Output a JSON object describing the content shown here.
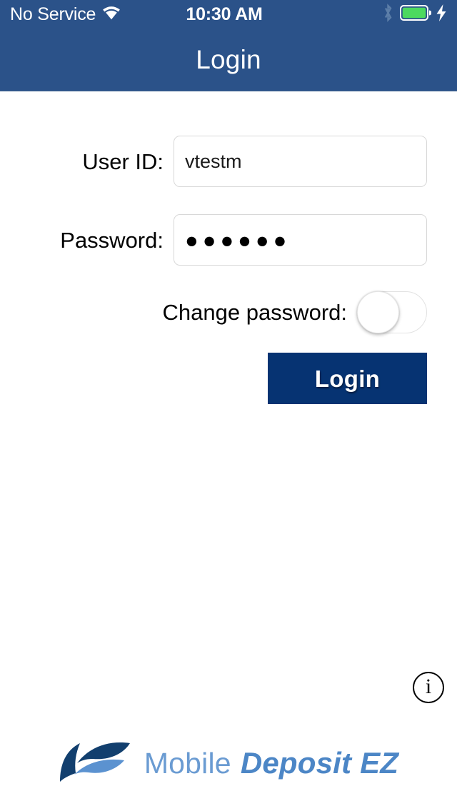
{
  "status_bar": {
    "carrier": "No Service",
    "time": "10:30 AM",
    "wifi_icon": "wifi-icon",
    "bluetooth_icon": "bluetooth-icon",
    "battery_icon": "battery-full-icon",
    "charging_icon": "lightning-bolt-icon",
    "battery_color": "#4cd95f",
    "bluetooth_color": "#5c7ea8"
  },
  "nav_bar": {
    "title": "Login",
    "background_color": "#2b5289"
  },
  "form": {
    "user_id": {
      "label": "User ID:",
      "value": "vtestm",
      "placeholder": ""
    },
    "password": {
      "label": "Password:",
      "value": "●●●●●●",
      "placeholder": ""
    },
    "change_password": {
      "label": "Change password:",
      "state": "off"
    }
  },
  "login_button": {
    "label": "Login",
    "background_color": "#063372"
  },
  "info_button": {
    "glyph": "i",
    "icon": "info-circle-icon"
  },
  "logo": {
    "mark_icon": "wave-logo-mark",
    "word_one": "Mobile",
    "word_two": "Deposit EZ",
    "color_light": "#6a9bd2",
    "color_dark": "#123f6e"
  }
}
